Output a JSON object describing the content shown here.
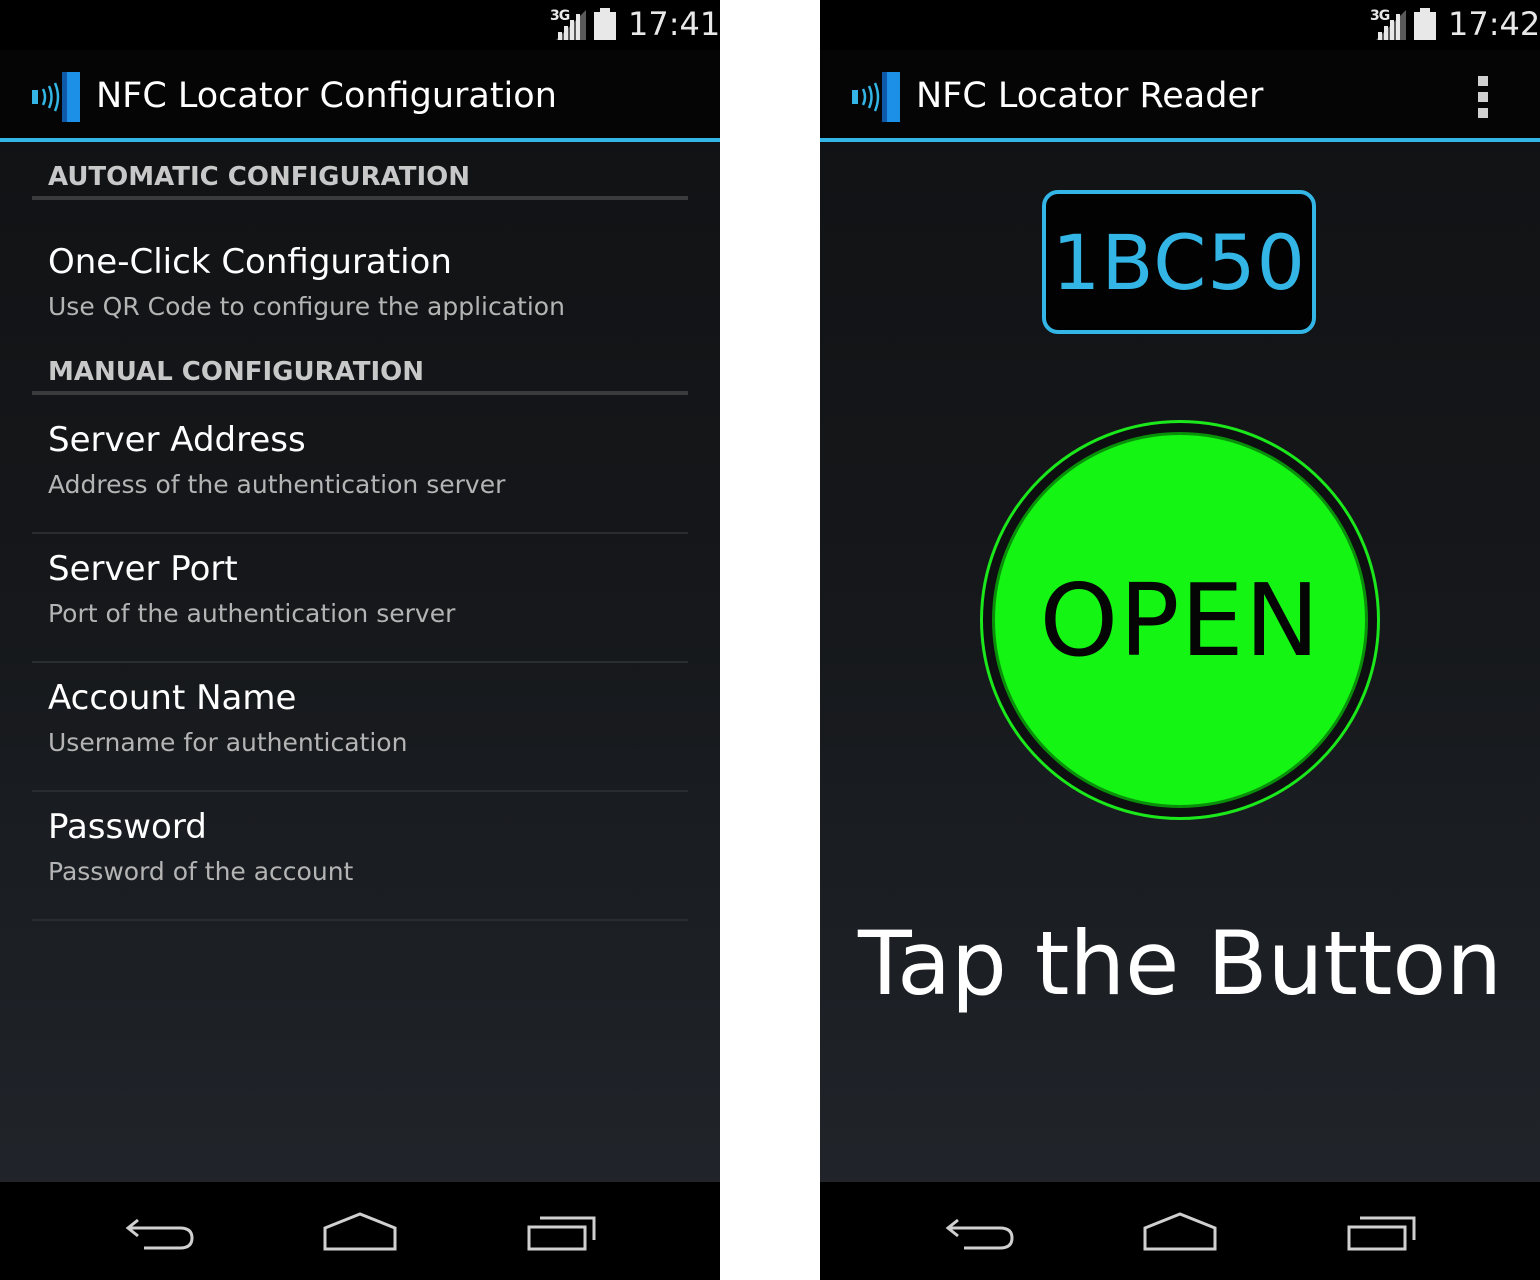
{
  "left_screen": {
    "status_bar": {
      "network": "3G",
      "time": "17:41"
    },
    "action_bar": {
      "title": "NFC Locator Configuration",
      "icon": "nfc-app-icon"
    },
    "sections": [
      {
        "header": "AUTOMATIC CONFIGURATION",
        "items": [
          {
            "title": "One-Click Configuration",
            "summary": "Use QR Code to configure the application"
          }
        ]
      },
      {
        "header": "MANUAL CONFIGURATION",
        "items": [
          {
            "title": "Server Address",
            "summary": "Address of the authentication server"
          },
          {
            "title": "Server Port",
            "summary": "Port of the authentication server"
          },
          {
            "title": "Account Name",
            "summary": "Username for authentication"
          },
          {
            "title": "Password",
            "summary": "Password of the account"
          }
        ]
      }
    ],
    "nav_bar": {
      "icons": [
        "back-icon",
        "home-icon",
        "recent-apps-icon"
      ]
    }
  },
  "right_screen": {
    "status_bar": {
      "network": "3G",
      "time": "17:42"
    },
    "action_bar": {
      "title": "NFC Locator Reader",
      "icon": "nfc-app-icon",
      "overflow_icon": "overflow-menu-icon"
    },
    "code": "1BC50",
    "open_button_label": "OPEN",
    "instruction": "Tap the Button",
    "nav_bar": {
      "icons": [
        "back-icon",
        "home-icon",
        "recent-apps-icon"
      ]
    }
  },
  "colors": {
    "accent": "#33b5e5",
    "open_green": "#14f514",
    "background": "#15171a",
    "bar_black": "#000000"
  }
}
